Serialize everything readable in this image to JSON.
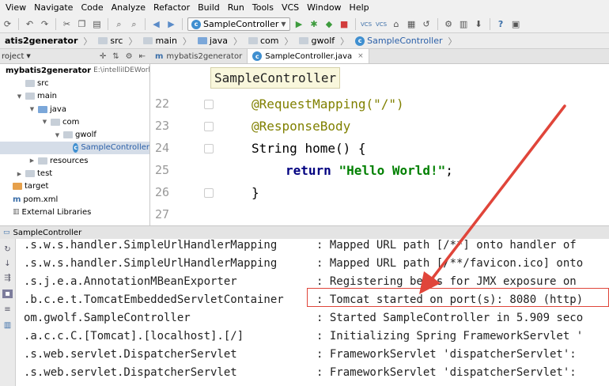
{
  "menu": [
    "View",
    "Navigate",
    "Code",
    "Analyze",
    "Refactor",
    "Build",
    "Run",
    "Tools",
    "VCS",
    "Window",
    "Help"
  ],
  "toolbar": {
    "run_config": "SampleController",
    "icons": [
      "sync-icon",
      "undo-icon",
      "redo-icon",
      "cut-icon",
      "copy-icon",
      "paste-icon",
      "find-icon",
      "replace-icon",
      "back-icon",
      "forward-icon",
      "run-icon",
      "debug-icon",
      "coverage-icon",
      "stop-icon",
      "vcs-update-icon",
      "vcs-commit-icon",
      "vcs-history-icon",
      "revert-icon",
      "settings-icon",
      "sdk-icon",
      "help-icon",
      "sidebar-toggle-icon"
    ]
  },
  "breadcrumbs": [
    "atis2generator",
    "src",
    "main",
    "java",
    "com",
    "gwolf",
    "SampleController"
  ],
  "project_panel": {
    "title": "roject",
    "root": "mybatis2generator",
    "root_path": "E:\\intelliIDEWorkspa",
    "items": [
      {
        "label": "src",
        "level": 1,
        "icon": "folder",
        "arrow": ""
      },
      {
        "label": "main",
        "level": 1,
        "icon": "folder",
        "arrow": "▼"
      },
      {
        "label": "java",
        "level": 2,
        "icon": "folder-blue",
        "arrow": "▼"
      },
      {
        "label": "com",
        "level": 3,
        "icon": "folder",
        "arrow": "▼"
      },
      {
        "label": "gwolf",
        "level": 4,
        "icon": "folder",
        "arrow": "▼"
      },
      {
        "label": "SampleController",
        "level": 5,
        "icon": "class",
        "arrow": "",
        "selected": true
      },
      {
        "label": "resources",
        "level": 2,
        "icon": "folder",
        "arrow": "▶"
      },
      {
        "label": "test",
        "level": 1,
        "icon": "folder",
        "arrow": "▶"
      },
      {
        "label": "target",
        "level": 0,
        "icon": "folder-orange",
        "arrow": ""
      },
      {
        "label": "pom.xml",
        "level": 0,
        "icon": "maven",
        "arrow": ""
      },
      {
        "label": "External Libraries",
        "level": 0,
        "icon": "libs",
        "arrow": ""
      }
    ]
  },
  "tabs": [
    {
      "label": "mybatis2generator",
      "active": false
    },
    {
      "label": "SampleController.java",
      "active": true,
      "close": "×"
    }
  ],
  "editor": {
    "tooltip": "SampleController",
    "line_numbers": [
      "22",
      "23",
      "24",
      "25",
      "26",
      "27"
    ],
    "lines": {
      "l22": "@RequestMapping(\"/\")",
      "l23": "@ResponseBody",
      "l24_type": "String ",
      "l24_name": "home",
      "l24_rest": "() {",
      "l25_kw": "return ",
      "l25_str": "\"Hello World!\"",
      "l25_end": ";",
      "l26": "}"
    }
  },
  "run_panel": {
    "title": "SampleController",
    "logger_lines": [
      ".s.w.s.handler.SimpleUrlHandlerMapping",
      ".s.w.s.handler.SimpleUrlHandlerMapping",
      ".s.j.e.a.AnnotationMBeanExporter",
      ".b.c.e.t.TomcatEmbeddedServletContainer",
      "om.gwolf.SampleController",
      ".a.c.c.C.[Tomcat].[localhost].[/]",
      ".s.web.servlet.DispatcherServlet",
      ".s.web.servlet.DispatcherServlet"
    ],
    "message_lines": [
      ": Mapped URL path [/**] onto handler of",
      ": Mapped URL path [/**/favicon.ico] onto",
      ": Registering beans for JMX exposure on",
      ": Tomcat started on port(s): 8080 (http)",
      ": Started SampleController in 5.909 seco",
      ": Initializing Spring FrameworkServlet '",
      ": FrameworkServlet 'dispatcherServlet':",
      ": FrameworkServlet 'dispatcherServlet':"
    ]
  },
  "colors": {
    "highlight": "#e0453a",
    "annotation": "#808000",
    "keyword": "#000080",
    "string": "#008000"
  }
}
